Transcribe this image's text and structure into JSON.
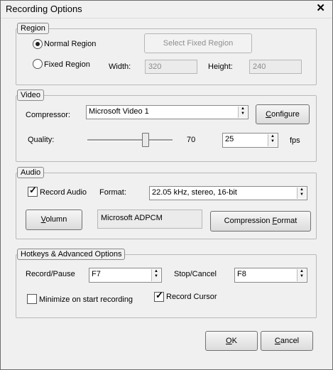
{
  "window": {
    "title": "Recording Options"
  },
  "region": {
    "label": "Region",
    "normal_label": "Normal Region",
    "fixed_label": "Fixed Region",
    "select_fixed_button": "Select Fixed Region",
    "width_label": "Width:",
    "width_value": "320",
    "height_label": "Height:",
    "height_value": "240",
    "selected": "normal"
  },
  "video": {
    "label": "Video",
    "compressor_label": "Compressor:",
    "compressor_value": "Microsoft Video 1",
    "configure_button": {
      "pre": "",
      "key": "C",
      "post": "onfigure"
    },
    "quality_label": "Quality:",
    "quality_value": "70",
    "fps_value": "25",
    "fps_label": "fps"
  },
  "audio": {
    "label": "Audio",
    "record_audio_label": "Record Audio",
    "record_audio_checked": true,
    "format_label": "Format:",
    "format_value": "22.05 kHz, stereo, 16-bit",
    "volumn_button": {
      "pre": "",
      "key": "V",
      "post": "olumn"
    },
    "codec_value": "Microsoft ADPCM",
    "compression_button": {
      "pre": "Compression ",
      "key": "F",
      "post": "ormat"
    }
  },
  "hotkeys": {
    "label": "Hotkeys & Advanced Options",
    "record_pause_label": "Record/Pause",
    "record_pause_value": "F7",
    "stop_cancel_label": "Stop/Cancel",
    "stop_cancel_value": "F8",
    "minimize_label": "Minimize on start recording",
    "minimize_checked": false,
    "record_cursor_label": "Record Cursor",
    "record_cursor_checked": true
  },
  "footer": {
    "ok_button": {
      "pre": "",
      "key": "O",
      "post": "K"
    },
    "cancel_button": {
      "pre": "",
      "key": "C",
      "post": "ancel"
    }
  }
}
